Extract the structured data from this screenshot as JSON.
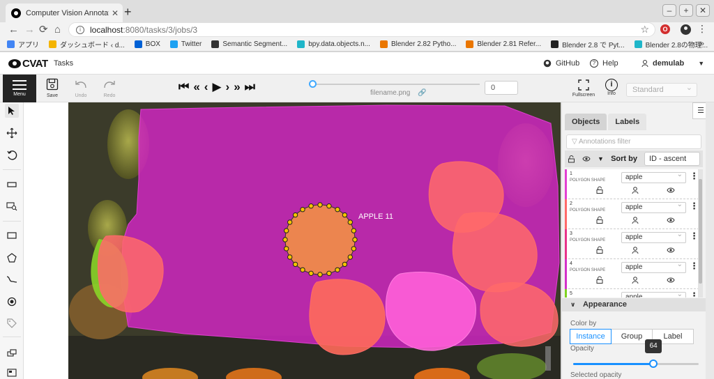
{
  "browser": {
    "tab_title": "Computer Vision Annotation To",
    "url_host": "localhost",
    "url_path": ":8080/tasks/3/jobs/3",
    "bookmarks": [
      {
        "label": "アプリ",
        "color": "#4285f4"
      },
      {
        "label": "ダッシュボード ‹ d...",
        "color": "#f4b400"
      },
      {
        "label": "BOX",
        "color": "#0061d5"
      },
      {
        "label": "Twitter",
        "color": "#1da1f2"
      },
      {
        "label": "Semantic Segment...",
        "color": "#333333"
      },
      {
        "label": "bpy.data.objects.n...",
        "color": "#1fb6c9"
      },
      {
        "label": "Blender 2.82 Pytho...",
        "color": "#ea7600"
      },
      {
        "label": "Blender 2.81 Refer...",
        "color": "#ea7600"
      },
      {
        "label": "Blender 2.8 で Pyt...",
        "color": "#222222"
      },
      {
        "label": "Blender 2.8の物理...",
        "color": "#1fb6c9"
      }
    ],
    "bookmarks_more": "»"
  },
  "header": {
    "logo": "CVAT",
    "tasks": "Tasks",
    "github": "GitHub",
    "help": "Help",
    "user": "demulab"
  },
  "toolbar": {
    "menu": "Menu",
    "save": "Save",
    "undo": "Undo",
    "redo": "Redo",
    "filename": "filename.png",
    "frame": "0",
    "fullscreen": "Fullscreen",
    "info": "Info",
    "workspace": "Standard"
  },
  "canvas": {
    "selected_label": "APPLE 11"
  },
  "sidebar": {
    "tabs": [
      "Objects",
      "Labels"
    ],
    "filter_placeholder": "Annotations filter",
    "sort_label": "Sort by",
    "sort_value": "ID - ascent",
    "objects": [
      {
        "id": "1",
        "type": "POLYGON SHAPE",
        "label": "apple",
        "color": "#e23fd2"
      },
      {
        "id": "2",
        "type": "POLYGON SHAPE",
        "label": "apple",
        "color": "#ff6a6a"
      },
      {
        "id": "3",
        "type": "POLYGON SHAPE",
        "label": "apple",
        "color": "#e8338a"
      },
      {
        "id": "4",
        "type": "POLYGON SHAPE",
        "label": "apple",
        "color": "#d331c9"
      },
      {
        "id": "5",
        "type": "",
        "label": "apple",
        "color": "#7ed321"
      }
    ],
    "appearance": {
      "title": "Appearance",
      "color_by": "Color by",
      "options": [
        "Instance",
        "Group",
        "Label"
      ],
      "selected_option": "Instance",
      "opacity_label": "Opacity",
      "opacity_value": 64,
      "selected_opacity_label": "Selected opacity"
    }
  }
}
